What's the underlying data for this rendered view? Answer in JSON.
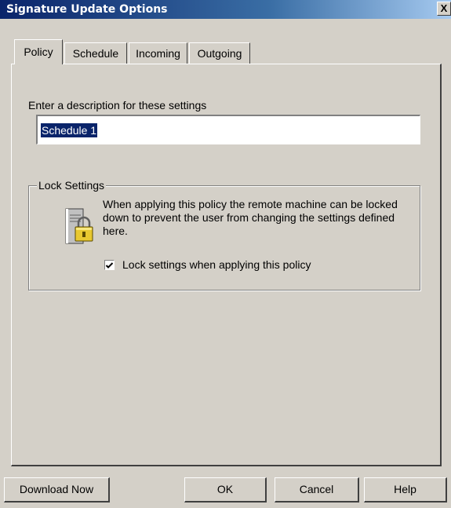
{
  "window": {
    "title": "Signature Update Options",
    "close_label": "X"
  },
  "tabs": [
    {
      "label": "Policy",
      "active": true
    },
    {
      "label": "Schedule",
      "active": false
    },
    {
      "label": "Incoming",
      "active": false
    },
    {
      "label": "Outgoing",
      "active": false
    }
  ],
  "policy": {
    "description_label": "Enter a description for these settings",
    "description_value": "Schedule 1",
    "lock_group_title": "Lock Settings",
    "lock_description": "When applying this policy the remote machine can be locked down to prevent the user from changing the settings defined here.",
    "lock_checkbox_label": "Lock settings when applying this policy",
    "lock_checkbox_checked": true,
    "icon": "computer-lock-icon"
  },
  "buttons": {
    "download_now": "Download Now",
    "ok": "OK",
    "cancel": "Cancel",
    "help": "Help"
  }
}
